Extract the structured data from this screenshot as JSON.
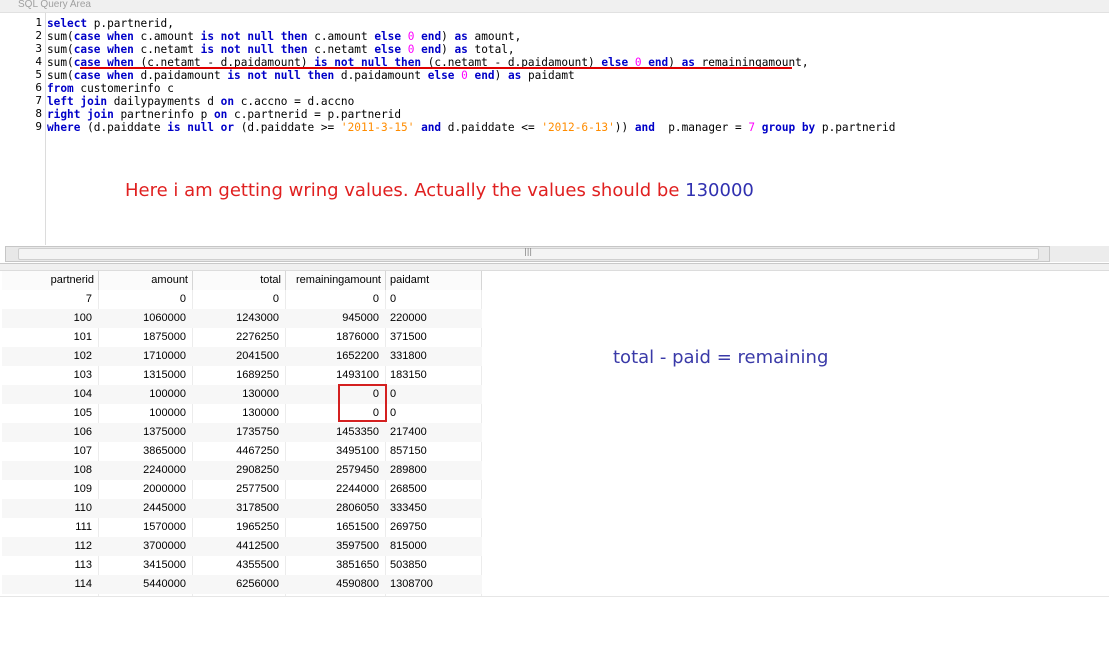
{
  "panel": {
    "title": "SQL Query Area"
  },
  "editor": {
    "line_numbers": [
      "1",
      "2",
      "3",
      "4",
      "5",
      "6",
      "7",
      "8",
      "9"
    ],
    "lines": [
      [
        {
          "t": "select",
          "c": "kw"
        },
        {
          "t": " p.partnerid,",
          "c": ""
        }
      ],
      [
        {
          "t": "sum(",
          "c": ""
        },
        {
          "t": "case when",
          "c": "kw"
        },
        {
          "t": " c.amount ",
          "c": ""
        },
        {
          "t": "is not null then",
          "c": "kw"
        },
        {
          "t": " c.amount ",
          "c": ""
        },
        {
          "t": "else",
          "c": "kw"
        },
        {
          "t": " ",
          "c": ""
        },
        {
          "t": "0",
          "c": "num"
        },
        {
          "t": " ",
          "c": ""
        },
        {
          "t": "end",
          "c": "kw"
        },
        {
          "t": ") ",
          "c": ""
        },
        {
          "t": "as",
          "c": "kw"
        },
        {
          "t": " amount,",
          "c": ""
        }
      ],
      [
        {
          "t": "sum(",
          "c": ""
        },
        {
          "t": "case when",
          "c": "kw"
        },
        {
          "t": " c.netamt ",
          "c": ""
        },
        {
          "t": "is not null then",
          "c": "kw"
        },
        {
          "t": " c.netamt ",
          "c": ""
        },
        {
          "t": "else",
          "c": "kw"
        },
        {
          "t": " ",
          "c": ""
        },
        {
          "t": "0",
          "c": "num"
        },
        {
          "t": " ",
          "c": ""
        },
        {
          "t": "end",
          "c": "kw"
        },
        {
          "t": ") ",
          "c": ""
        },
        {
          "t": "as",
          "c": "kw"
        },
        {
          "t": " total,",
          "c": ""
        }
      ],
      [
        {
          "t": "sum(",
          "c": ""
        },
        {
          "t": "case when",
          "c": "kw"
        },
        {
          "t": " (c.netamt - d.paidamount) ",
          "c": ""
        },
        {
          "t": "is not null then",
          "c": "kw"
        },
        {
          "t": " (c.netamt - d.paidamount) ",
          "c": ""
        },
        {
          "t": "else",
          "c": "kw"
        },
        {
          "t": " ",
          "c": ""
        },
        {
          "t": "0",
          "c": "num"
        },
        {
          "t": " ",
          "c": ""
        },
        {
          "t": "end",
          "c": "kw"
        },
        {
          "t": ") ",
          "c": ""
        },
        {
          "t": "as",
          "c": "kw"
        },
        {
          "t": " remainingamount,",
          "c": ""
        }
      ],
      [
        {
          "t": "sum(",
          "c": ""
        },
        {
          "t": "case when",
          "c": "kw"
        },
        {
          "t": " d.paidamount ",
          "c": ""
        },
        {
          "t": "is not null then",
          "c": "kw"
        },
        {
          "t": " d.paidamount ",
          "c": ""
        },
        {
          "t": "else",
          "c": "kw"
        },
        {
          "t": " ",
          "c": ""
        },
        {
          "t": "0",
          "c": "num"
        },
        {
          "t": " ",
          "c": ""
        },
        {
          "t": "end",
          "c": "kw"
        },
        {
          "t": ") ",
          "c": ""
        },
        {
          "t": "as",
          "c": "kw"
        },
        {
          "t": " paidamt",
          "c": ""
        }
      ],
      [
        {
          "t": "from",
          "c": "kw"
        },
        {
          "t": " customerinfo c",
          "c": ""
        }
      ],
      [
        {
          "t": "left join",
          "c": "kw"
        },
        {
          "t": " dailypayments d ",
          "c": ""
        },
        {
          "t": "on",
          "c": "kw"
        },
        {
          "t": " c.accno = d.accno",
          "c": ""
        }
      ],
      [
        {
          "t": "right join",
          "c": "kw"
        },
        {
          "t": " partnerinfo p ",
          "c": ""
        },
        {
          "t": "on",
          "c": "kw"
        },
        {
          "t": " c.partnerid = p.partnerid",
          "c": ""
        }
      ],
      [
        {
          "t": "where",
          "c": "kw"
        },
        {
          "t": " (d.paiddate ",
          "c": ""
        },
        {
          "t": "is null or",
          "c": "kw"
        },
        {
          "t": " (d.paiddate >= ",
          "c": ""
        },
        {
          "t": "'2011-3-15'",
          "c": "str"
        },
        {
          "t": " ",
          "c": ""
        },
        {
          "t": "and",
          "c": "kw"
        },
        {
          "t": " d.paiddate <= ",
          "c": ""
        },
        {
          "t": "'2012-6-13'",
          "c": "str"
        },
        {
          "t": ")) ",
          "c": ""
        },
        {
          "t": "and",
          "c": "kw"
        },
        {
          "t": "  p.manager = ",
          "c": ""
        },
        {
          "t": "7",
          "c": "num"
        },
        {
          "t": " ",
          "c": ""
        },
        {
          "t": "group by",
          "c": "kw"
        },
        {
          "t": " p.partnerid",
          "c": ""
        }
      ]
    ]
  },
  "annotations": {
    "red_note_prefix": "Here i am getting wring values. Actually the values should be ",
    "red_note_value": "130000",
    "blue_note": "total - paid = remaining"
  },
  "grid": {
    "columns": [
      "partnerid",
      "amount",
      "total",
      "remainingamount",
      "paidamt"
    ],
    "rows": [
      [
        "7",
        "0",
        "0",
        "0",
        "0"
      ],
      [
        "100",
        "1060000",
        "1243000",
        "945000",
        "220000"
      ],
      [
        "101",
        "1875000",
        "2276250",
        "1876000",
        "371500"
      ],
      [
        "102",
        "1710000",
        "2041500",
        "1652200",
        "331800"
      ],
      [
        "103",
        "1315000",
        "1689250",
        "1493100",
        "183150"
      ],
      [
        "104",
        "100000",
        "130000",
        "0",
        "0"
      ],
      [
        "105",
        "100000",
        "130000",
        "0",
        "0"
      ],
      [
        "106",
        "1375000",
        "1735750",
        "1453350",
        "217400"
      ],
      [
        "107",
        "3865000",
        "4467250",
        "3495100",
        "857150"
      ],
      [
        "108",
        "2240000",
        "2908250",
        "2579450",
        "289800"
      ],
      [
        "109",
        "2000000",
        "2577500",
        "2244000",
        "268500"
      ],
      [
        "110",
        "2445000",
        "3178500",
        "2806050",
        "333450"
      ],
      [
        "111",
        "1570000",
        "1965250",
        "1651500",
        "269750"
      ],
      [
        "112",
        "3700000",
        "4412500",
        "3597500",
        "815000"
      ],
      [
        "113",
        "3415000",
        "4355500",
        "3851650",
        "503850"
      ],
      [
        "114",
        "5440000",
        "6256000",
        "4590800",
        "1308700"
      ]
    ]
  }
}
